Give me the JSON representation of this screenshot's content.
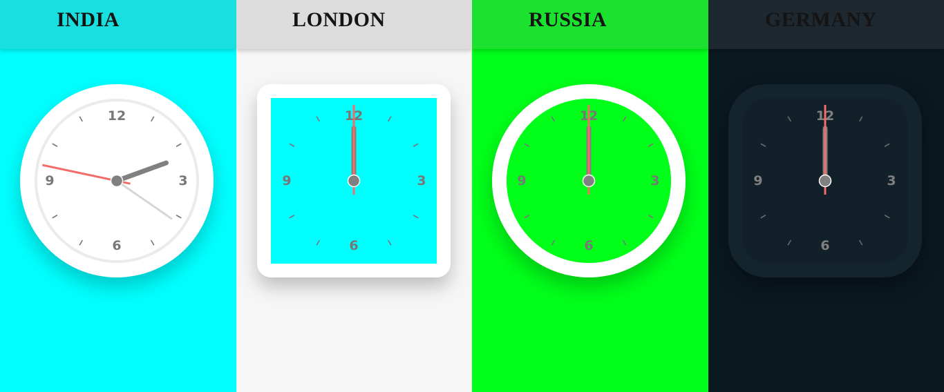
{
  "cities": [
    {
      "name": "INDIA",
      "shape": "circle",
      "colors": {
        "panel_bg": "#00ffff",
        "header_bg": "#19e0e0",
        "title": "#141414",
        "bezel": "#ffffff",
        "face": "#ffffff",
        "numbers": "#777777",
        "ticks": "#777777",
        "hour_hand": "#808080",
        "minute_hand": "#d6d6d6",
        "second_hand": "#f26d6a",
        "pin": "#808080"
      },
      "time": {
        "hour": 2,
        "minute": 20,
        "second": 47
      }
    },
    {
      "name": "LONDON",
      "shape": "square",
      "colors": {
        "panel_bg": "#f6f6f6",
        "header_bg": "#dcdcdc",
        "title": "#141414",
        "bezel": "#ffffff",
        "face": "#00ffff",
        "numbers": "#777777",
        "ticks": "#777777",
        "hour_hand": "#808080",
        "minute_hand": "#d6d6d6",
        "second_hand": "#f26d6a",
        "pin": "#808080"
      },
      "time": {
        "hour": 12,
        "minute": 0,
        "second": 0
      }
    },
    {
      "name": "RUSSIA",
      "shape": "circle",
      "colors": {
        "panel_bg": "#00ff19",
        "header_bg": "#1ae22e",
        "title": "#141414",
        "bezel": "#ffffff",
        "face": "#00ff19",
        "numbers": "#777777",
        "ticks": "#777777",
        "hour_hand": "#808080",
        "minute_hand": "#d6d6d6",
        "second_hand": "#f26d6a",
        "pin": "#808080"
      },
      "time": {
        "hour": 12,
        "minute": 0,
        "second": 0
      }
    },
    {
      "name": "GERMANY",
      "shape": "rounded",
      "colors": {
        "panel_bg": "#0a1820",
        "header_bg": "#1e2830",
        "title": "#141414",
        "bezel": "#14242d",
        "face": "#112029",
        "numbers": "#808080",
        "ticks": "#6a6a6a",
        "hour_hand": "#808080",
        "minute_hand": "#d6d6d6",
        "second_hand": "#f26d6a",
        "pin": "#808080"
      },
      "time": {
        "hour": 12,
        "minute": 0,
        "second": 0
      }
    }
  ],
  "dial_numbers": [
    "12",
    "3",
    "6",
    "9"
  ]
}
